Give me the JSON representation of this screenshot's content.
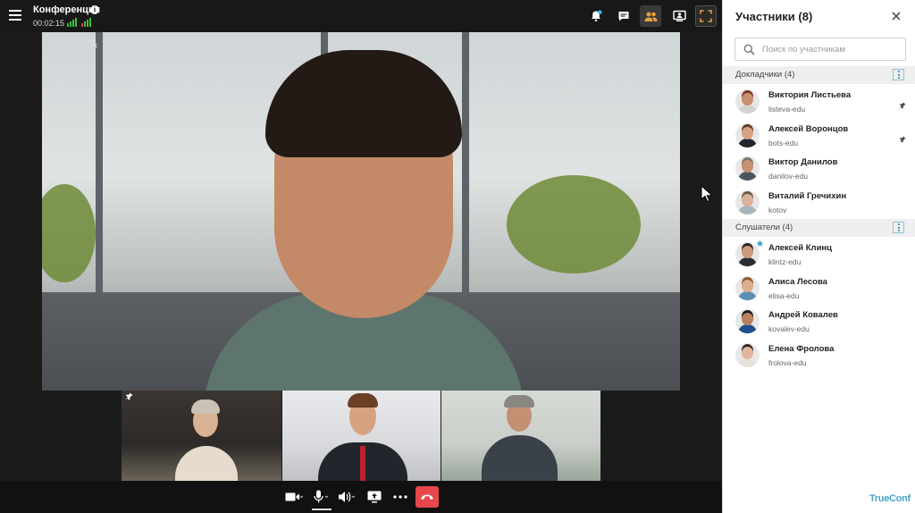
{
  "topbar": {
    "conference_title": "Конференция",
    "timer": "00:02:15"
  },
  "panel": {
    "title": "Участники (8)",
    "search_placeholder": "Поиск по участникам",
    "groups": [
      {
        "label": "Докладчики (4)",
        "members": [
          {
            "name": "Виктория Листьева",
            "login": "listeva-edu",
            "pinned": true,
            "skin": "#c98e6e",
            "hair": "#7a3b22",
            "cloth": "#d6d3cf"
          },
          {
            "name": "Алексей Воронцов",
            "login": "bots-edu",
            "pinned": true,
            "skin": "#d6a482",
            "hair": "#5b3a22",
            "cloth": "#23262c"
          },
          {
            "name": "Виктор Данилов",
            "login": "danilov-edu",
            "pinned": false,
            "skin": "#c69072",
            "hair": "#7d7469",
            "cloth": "#4b5561"
          },
          {
            "name": "Виталий Гречихин",
            "login": "kotov",
            "pinned": false,
            "skin": "#d9b297",
            "hair": "#6b5a4b",
            "cloth": "#a8b4bc"
          }
        ]
      },
      {
        "label": "Слушатели (4)",
        "members": [
          {
            "name": "Алексей Клинц",
            "login": "klintz-edu",
            "pinned": false,
            "starred": true,
            "skin": "#cf9b7c",
            "hair": "#2c241e",
            "cloth": "#2a2d33"
          },
          {
            "name": "Алиса Лесова",
            "login": "elisa-edu",
            "pinned": false,
            "skin": "#dcae8f",
            "hair": "#8c5a33",
            "cloth": "#5b8fb2"
          },
          {
            "name": "Андрей Ковалев",
            "login": "kovalev-edu",
            "pinned": false,
            "skin": "#b98162",
            "hair": "#1e1a18",
            "cloth": "#1f4f8a"
          },
          {
            "name": "Елена Фролова",
            "login": "frolova-edu",
            "pinned": false,
            "skin": "#e0b59a",
            "hair": "#3b2a22",
            "cloth": "#e7e1dc"
          }
        ]
      }
    ]
  },
  "brand": "TrueConf",
  "colors": {
    "accent": "#4ba3c7",
    "hangup": "#e5474b",
    "active_button": "#e5a13c",
    "signal_good": "#3fbf3f",
    "signal_bad": "#e04040"
  },
  "icons": {
    "topbar": [
      "bell-icon",
      "chat-icon",
      "participants-icon",
      "layout-icon",
      "fullscreen-icon"
    ],
    "controls": [
      "camera-icon",
      "microphone-icon",
      "speaker-icon",
      "share-screen-icon",
      "more-icon",
      "hangup-icon"
    ]
  }
}
